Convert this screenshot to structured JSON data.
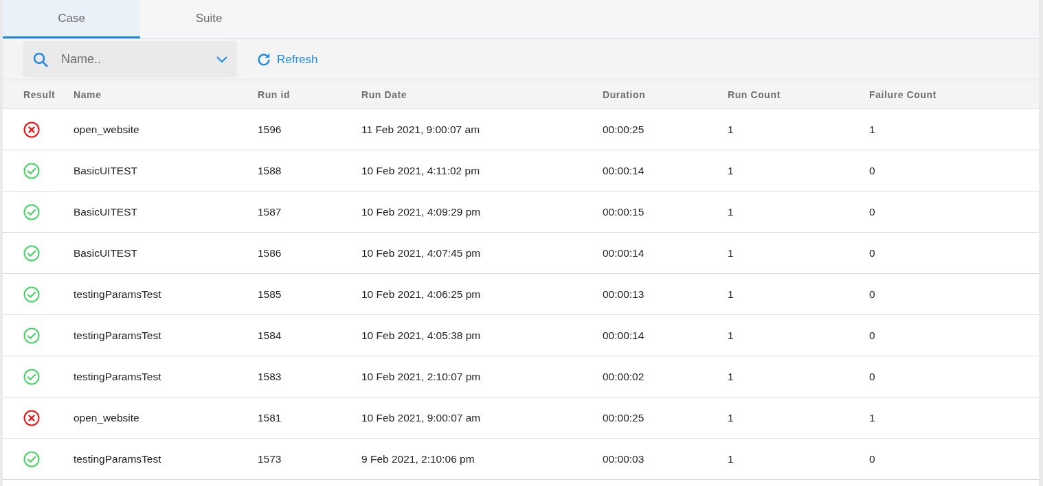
{
  "tabs": [
    {
      "label": "Case",
      "selected": true
    },
    {
      "label": "Suite",
      "selected": false
    }
  ],
  "toolbar": {
    "search": {
      "placeholder": "Name.."
    },
    "refresh_button": "Refresh"
  },
  "table": {
    "columns": [
      "Result",
      "Name",
      "Run id",
      "Run Date",
      "Duration",
      "Run Count",
      "Failure Count"
    ],
    "rows": [
      {
        "kind": "failed",
        "name": "open_website",
        "run_id": "1596",
        "run_date": "11 Feb 2021, 9:00:07 am",
        "duration": "00:00:25",
        "run_count": "1",
        "failure_count": "1"
      },
      {
        "kind": "passed",
        "name": "BasicUITEST",
        "run_id": "1588",
        "run_date": "10 Feb 2021, 4:11:02 pm",
        "duration": "00:00:14",
        "run_count": "1",
        "failure_count": "0"
      },
      {
        "kind": "passed",
        "name": "BasicUITEST",
        "run_id": "1587",
        "run_date": "10 Feb 2021, 4:09:29 pm",
        "duration": "00:00:15",
        "run_count": "1",
        "failure_count": "0"
      },
      {
        "kind": "passed",
        "name": "BasicUITEST",
        "run_id": "1586",
        "run_date": "10 Feb 2021, 4:07:45 pm",
        "duration": "00:00:14",
        "run_count": "1",
        "failure_count": "0"
      },
      {
        "kind": "passed",
        "name": "testingParamsTest",
        "run_id": "1585",
        "run_date": "10 Feb 2021, 4:06:25 pm",
        "duration": "00:00:13",
        "run_count": "1",
        "failure_count": "0"
      },
      {
        "kind": "passed",
        "name": "testingParamsTest",
        "run_id": "1584",
        "run_date": "10 Feb 2021, 4:05:38 pm",
        "duration": "00:00:14",
        "run_count": "1",
        "failure_count": "0"
      },
      {
        "kind": "passed",
        "name": "testingParamsTest",
        "run_id": "1583",
        "run_date": "10 Feb 2021, 2:10:07 pm",
        "duration": "00:00:02",
        "run_count": "1",
        "failure_count": "0"
      },
      {
        "kind": "failed",
        "name": "open_website",
        "run_id": "1581",
        "run_date": "10 Feb 2021, 9:00:07 am",
        "duration": "00:00:25",
        "run_count": "1",
        "failure_count": "1"
      },
      {
        "kind": "passed",
        "name": "testingParamsTest",
        "run_id": "1573",
        "run_date": "9 Feb 2021, 2:10:06 pm",
        "duration": "00:00:03",
        "run_count": "1",
        "failure_count": "0"
      }
    ]
  }
}
